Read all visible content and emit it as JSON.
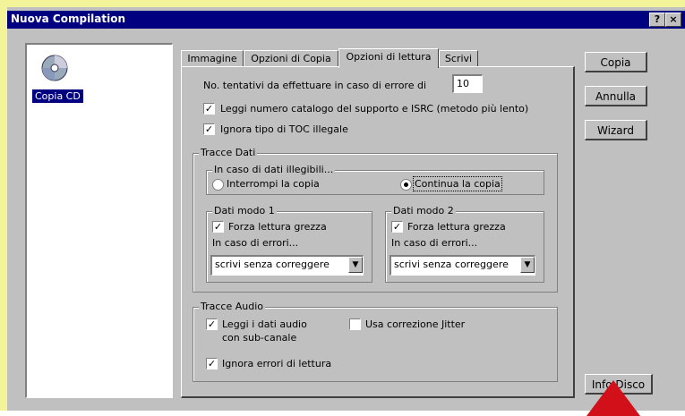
{
  "window": {
    "title": "Nuova Compilation",
    "help_btn": "?",
    "close_btn": "×"
  },
  "list": {
    "items": [
      {
        "label": "Copia CD",
        "icon": "cd-icon"
      }
    ]
  },
  "tabs": [
    {
      "label": "Immagine"
    },
    {
      "label": "Opzioni di Copia"
    },
    {
      "label": "Opzioni di lettura"
    },
    {
      "label": "Scrivi"
    }
  ],
  "read_options": {
    "retries_label": "No. tentativi da effettuare in caso di errore di",
    "retries_value": "10",
    "read_catalog_label": "Leggi numero catalogo del supporto e ISRC (metodo più lento)",
    "read_catalog_checked": true,
    "ignore_toc_label": "Ignora tipo di TOC illegale",
    "ignore_toc_checked": true
  },
  "data_tracks": {
    "group_title": "Tracce Dati",
    "unreadable": {
      "group_title": "In caso di dati illegibili...",
      "option_stop": "Interrompi la copia",
      "option_continue": "Continua la copia",
      "selected": "continue"
    },
    "mode1": {
      "group_title": "Dati modo 1",
      "force_raw_label": "Forza lettura grezza",
      "force_raw_checked": true,
      "on_errors_label": "In caso di errori...",
      "on_errors_value": "scrivi senza correggere"
    },
    "mode2": {
      "group_title": "Dati modo 2",
      "force_raw_label": "Forza lettura grezza",
      "force_raw_checked": true,
      "on_errors_label": "In caso di errori...",
      "on_errors_value": "scrivi senza correggere"
    }
  },
  "audio_tracks": {
    "group_title": "Tracce Audio",
    "read_subchannel_label_1": "Leggi i dati audio",
    "read_subchannel_label_2": "con sub-canale",
    "read_subchannel_checked": true,
    "jitter_label": "Usa correzione Jitter",
    "jitter_checked": false,
    "ignore_errors_label": "Ignora errori di lettura",
    "ignore_errors_checked": true
  },
  "buttons": {
    "copy": "Copia",
    "cancel": "Annulla",
    "wizard": "Wizard",
    "disc_info": "Info Disco"
  },
  "colors": {
    "title_bar": "#000080",
    "highlight_border": "#f3f39a",
    "annotation_arrow": "#d1101a"
  }
}
